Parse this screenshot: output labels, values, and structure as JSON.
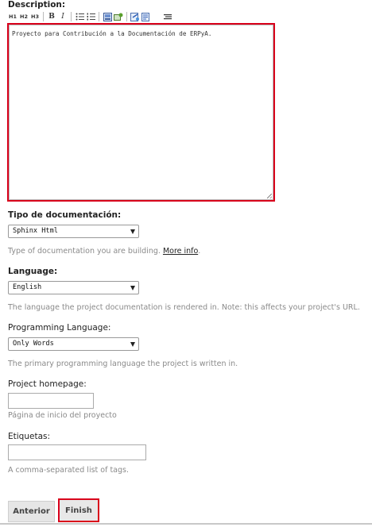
{
  "description": {
    "label": "Description:",
    "value": "Proyecto para Contribución a la Documentación de ERPyA."
  },
  "toolbar": {
    "h1": "H1",
    "h2": "H2",
    "h3": "H3",
    "bold": "B",
    "italic": "I"
  },
  "doc_type": {
    "label": "Tipo de documentación:",
    "value": "Sphinx Html",
    "help": "Type of documentation you are building.",
    "help_link": "More info"
  },
  "language": {
    "label": "Language:",
    "value": "English",
    "help": "The language the project documentation is rendered in. Note: this affects your project's URL."
  },
  "programming_language": {
    "label": "Programming Language:",
    "value": "Only Words",
    "help": "The primary programming language the project is written in."
  },
  "homepage": {
    "label": "Project homepage:",
    "value": "",
    "help": "Página de inicio del proyecto"
  },
  "tags": {
    "label": "Etiquetas:",
    "value": "",
    "help": "A comma-separated list of tags."
  },
  "buttons": {
    "back": "Anterior",
    "finish": "Finish"
  },
  "colors": {
    "highlight": "#d9001b"
  }
}
